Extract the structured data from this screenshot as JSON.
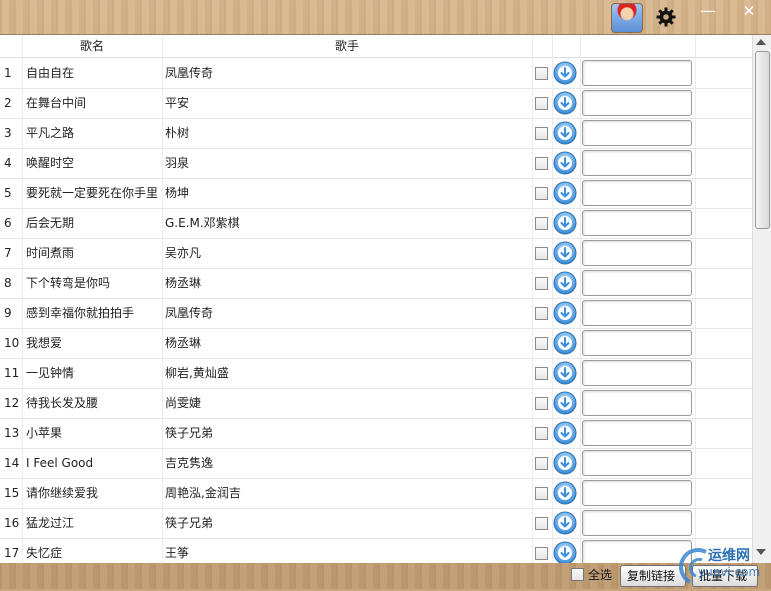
{
  "window": {
    "minimize_label": "—",
    "close_label": "✕",
    "avatar_icon": "mario-avatar",
    "settings_icon": "gear-icon"
  },
  "table": {
    "headers": {
      "num": "",
      "song": "歌名",
      "artist": "歌手"
    },
    "rows": [
      {
        "num": "1",
        "song": "自由自在",
        "artist": "凤凰传奇"
      },
      {
        "num": "2",
        "song": "在舞台中间",
        "artist": "平安"
      },
      {
        "num": "3",
        "song": "平凡之路",
        "artist": "朴树"
      },
      {
        "num": "4",
        "song": "唤醒时空",
        "artist": "羽泉"
      },
      {
        "num": "5",
        "song": "要死就一定要死在你手里",
        "artist": "杨坤"
      },
      {
        "num": "6",
        "song": "后会无期",
        "artist": "G.E.M.邓紫棋"
      },
      {
        "num": "7",
        "song": "时间煮雨",
        "artist": "吴亦凡"
      },
      {
        "num": "8",
        "song": "下个转弯是你吗",
        "artist": "杨丞琳"
      },
      {
        "num": "9",
        "song": "感到幸福你就拍拍手",
        "artist": "凤凰传奇"
      },
      {
        "num": "10",
        "song": "我想爱",
        "artist": "杨丞琳"
      },
      {
        "num": "11",
        "song": "一见钟情",
        "artist": "柳岩,黄灿盛"
      },
      {
        "num": "12",
        "song": "待我长发及腰",
        "artist": "尚雯婕"
      },
      {
        "num": "13",
        "song": "小苹果",
        "artist": "筷子兄弟"
      },
      {
        "num": "14",
        "song": "I Feel Good",
        "artist": "吉克隽逸"
      },
      {
        "num": "15",
        "song": "请你继续爱我",
        "artist": "周艳泓,金润吉"
      },
      {
        "num": "16",
        "song": "猛龙过江",
        "artist": "筷子兄弟"
      },
      {
        "num": "17",
        "song": "失忆症",
        "artist": "王筝"
      }
    ]
  },
  "footer": {
    "select_all_label": "全选",
    "copy_link_label": "复制链接",
    "batch_download_label": "批量下载"
  },
  "watermark": {
    "text": "运维网",
    "sub": "yunvi.com"
  },
  "colors": {
    "download_icon": "#3f8fd8",
    "accent": "#2b6fb5"
  }
}
